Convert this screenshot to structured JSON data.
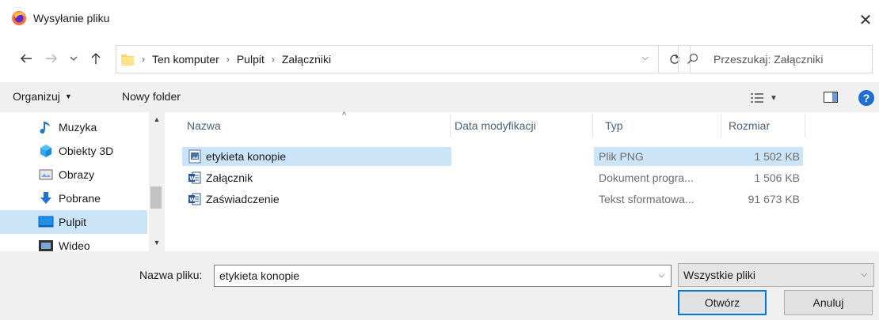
{
  "window": {
    "title": "Wysyłanie pliku",
    "close_glyph": "✕"
  },
  "address": {
    "breadcrumbs": [
      "Ten komputer",
      "Pulpit",
      "Załączniki"
    ],
    "search_placeholder": "Przeszukaj: Załączniki"
  },
  "toolbar": {
    "organize_label": "Organizuj",
    "new_folder_label": "Nowy folder"
  },
  "sidebar": {
    "items": [
      {
        "label": "Muzyka",
        "icon": "music-icon",
        "selected": false
      },
      {
        "label": "Obiekty 3D",
        "icon": "cube-3d-icon",
        "selected": false
      },
      {
        "label": "Obrazy",
        "icon": "pictures-icon",
        "selected": false
      },
      {
        "label": "Pobrane",
        "icon": "download-icon",
        "selected": false
      },
      {
        "label": "Pulpit",
        "icon": "desktop-icon",
        "selected": true
      },
      {
        "label": "Wideo",
        "icon": "video-icon",
        "selected": false
      }
    ]
  },
  "columns": {
    "name": "Nazwa",
    "modified": "Data modyfikacji",
    "type": "Typ",
    "size": "Rozmiar"
  },
  "files": [
    {
      "name": "etykieta konopie",
      "type": "Plik PNG",
      "size": "1 502 KB",
      "icon": "png-image-icon",
      "selected": true
    },
    {
      "name": "Załącznik",
      "type": "Dokument progra...",
      "size": "1 506 KB",
      "icon": "word-document-icon",
      "selected": false
    },
    {
      "name": "Zaświadczenie",
      "type": "Tekst sformatowa...",
      "size": "91 673 KB",
      "icon": "word-document-icon",
      "selected": false
    }
  ],
  "footer": {
    "filename_label": "Nazwa pliku:",
    "filename_value": "etykieta konopie",
    "filter_value": "Wszystkie pliki",
    "open_label": "Otwórz",
    "cancel_label": "Anuluj"
  },
  "colors": {
    "selection": "#cce4f7",
    "accent": "#0078d7",
    "help": "#1e6fd0"
  }
}
